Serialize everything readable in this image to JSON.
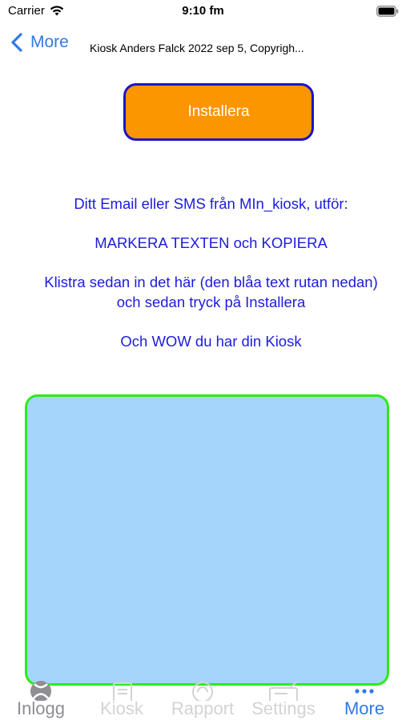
{
  "status_bar": {
    "carrier": "Carrier",
    "time": "9:10 fm"
  },
  "nav": {
    "back_label": "More",
    "title": "Kiosk Anders Falck 2022 sep 5, Copyrigh..."
  },
  "install_button": {
    "label": "Installera"
  },
  "instructions": [
    "Ditt Email eller SMS från MIn_kiosk, utför:",
    "MARKERA TEXTEN och KOPIERA",
    "Klistra sedan in det här (den blåa text rutan nedan) och sedan tryck på Installera",
    "Och WOW du har din Kiosk"
  ],
  "paste_area": {
    "value": ""
  },
  "tabs": [
    {
      "label": "Inlogg",
      "icon": "xbox-icon",
      "state": "normal"
    },
    {
      "label": "Kiosk",
      "icon": "document-icon",
      "state": "faded"
    },
    {
      "label": "Rapport",
      "icon": "report-icon",
      "state": "faded"
    },
    {
      "label": "Settings",
      "icon": "settings-icon",
      "state": "faded"
    },
    {
      "label": "More",
      "icon": "more-dots-icon",
      "state": "active"
    }
  ],
  "colors": {
    "accent": "#2f7ae5",
    "install_fill": "#fb9500",
    "install_border": "#1a14c9",
    "instruction_text": "#1c1cde",
    "paste_fill": "#a5d5fb",
    "paste_border": "#2bec16"
  }
}
